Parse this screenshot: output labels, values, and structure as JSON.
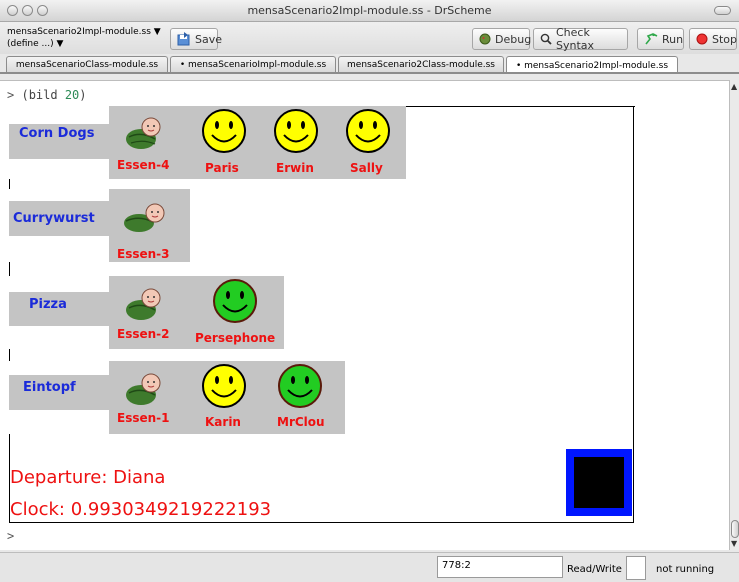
{
  "window": {
    "title": "mensaScenario2Impl-module.ss - DrScheme"
  },
  "toolbar": {
    "module_name": "mensaScenario2Impl-module.ss ▼",
    "define_menu": "(define ...) ▼",
    "save_label": "Save",
    "debug_label": "Debug",
    "check_syntax_label": "Check Syntax",
    "run_label": "Run",
    "stop_label": "Stop"
  },
  "tabs": [
    {
      "label": "mensaScenarioClass-module.ss"
    },
    {
      "label": "• mensaScenarioImpl-module.ss"
    },
    {
      "label": "mensaScenario2Class-module.ss"
    },
    {
      "label": "• mensaScenario2Impl-module.ss"
    }
  ],
  "repl": {
    "prompt": ">",
    "expr_open": "(bild",
    "expr_num": "20",
    "expr_close": ")",
    "prompt2": ">"
  },
  "scene": {
    "rows": [
      {
        "food": "Corn Dogs",
        "essen": "Essen-4",
        "guests": [
          {
            "name": "Paris",
            "color": "#ffff00"
          },
          {
            "name": "Erwin",
            "color": "#ffff00"
          },
          {
            "name": "Sally",
            "color": "#ffff00"
          }
        ]
      },
      {
        "food": "Currywurst",
        "essen": "Essen-3",
        "guests": []
      },
      {
        "food": "Pizza",
        "essen": "Essen-2",
        "guests": [
          {
            "name": "Persephone",
            "color": "#22cc22"
          }
        ]
      },
      {
        "food": "Eintopf",
        "essen": "Essen-1",
        "guests": [
          {
            "name": "Karin",
            "color": "#ffff00"
          },
          {
            "name": "MrClou",
            "color": "#22cc22"
          }
        ]
      }
    ],
    "departure": "Departure: Diana",
    "clock": "Clock: 0.9930349219222193"
  },
  "statusbar": {
    "position": "778:2",
    "read_write": "Read/Write",
    "running": "not running"
  },
  "colors": {
    "food_label": "#1b2bd9",
    "name_label": "#ee1111",
    "box": "#c4c4c4",
    "accent_box": "#0016ff"
  }
}
